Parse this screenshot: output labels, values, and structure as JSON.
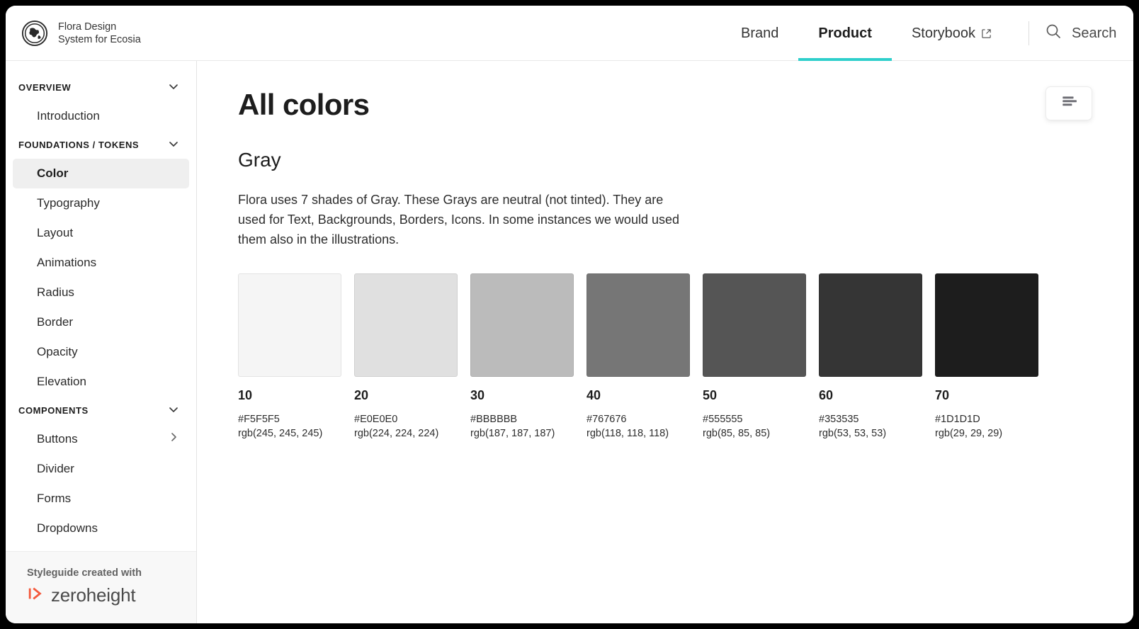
{
  "header": {
    "logo_icon": "globe-icon",
    "brand_text": "Flora Design\nSystem for Ecosia",
    "nav": [
      {
        "label": "Brand",
        "active": false,
        "external": false
      },
      {
        "label": "Product",
        "active": true,
        "external": false
      },
      {
        "label": "Storybook",
        "active": false,
        "external": true
      }
    ],
    "search_label": "Search",
    "search_icon": "search-icon",
    "accent_color": "#2ECFCB"
  },
  "sidebar": {
    "groups": [
      {
        "title": "OVERVIEW",
        "chevron": "chevron-down-icon",
        "items": [
          {
            "label": "Introduction",
            "active": false,
            "chevron": null
          }
        ]
      },
      {
        "title": "FOUNDATIONS / TOKENS",
        "chevron": "chevron-down-icon",
        "items": [
          {
            "label": "Color",
            "active": true,
            "chevron": null
          },
          {
            "label": "Typography",
            "active": false,
            "chevron": null
          },
          {
            "label": "Layout",
            "active": false,
            "chevron": null
          },
          {
            "label": "Animations",
            "active": false,
            "chevron": null
          },
          {
            "label": "Radius",
            "active": false,
            "chevron": null
          },
          {
            "label": "Border",
            "active": false,
            "chevron": null
          },
          {
            "label": "Opacity",
            "active": false,
            "chevron": null
          },
          {
            "label": "Elevation",
            "active": false,
            "chevron": null
          }
        ]
      },
      {
        "title": "COMPONENTS",
        "chevron": "chevron-down-icon",
        "items": [
          {
            "label": "Buttons",
            "active": false,
            "chevron": "chevron-right-icon"
          },
          {
            "label": "Divider",
            "active": false,
            "chevron": null
          },
          {
            "label": "Forms",
            "active": false,
            "chevron": null
          },
          {
            "label": "Dropdowns",
            "active": false,
            "chevron": null
          }
        ]
      }
    ],
    "footer": {
      "caption": "Styleguide created with",
      "logo_mark": "zeroheight-mark-icon",
      "logo_word": "zeroheight",
      "logo_color": "#F4593C"
    }
  },
  "main": {
    "page_title": "All colors",
    "layout_button_icon": "text-align-icon",
    "section": {
      "title": "Gray",
      "description": "Flora uses 7 shades of Gray. These Grays are neutral (not tinted). They are used for Text, Backgrounds, Borders, Icons. In some instances we would used them also in the illustrations.",
      "swatches": [
        {
          "name": "10",
          "hex": "#F5F5F5",
          "rgb": "rgb(245, 245, 245)"
        },
        {
          "name": "20",
          "hex": "#E0E0E0",
          "rgb": "rgb(224, 224, 224)"
        },
        {
          "name": "30",
          "hex": "#BBBBBB",
          "rgb": "rgb(187, 187, 187)"
        },
        {
          "name": "40",
          "hex": "#767676",
          "rgb": "rgb(118, 118, 118)"
        },
        {
          "name": "50",
          "hex": "#555555",
          "rgb": "rgb(85, 85, 85)"
        },
        {
          "name": "60",
          "hex": "#353535",
          "rgb": "rgb(53, 53, 53)"
        },
        {
          "name": "70",
          "hex": "#1D1D1D",
          "rgb": "rgb(29, 29, 29)"
        }
      ]
    }
  }
}
